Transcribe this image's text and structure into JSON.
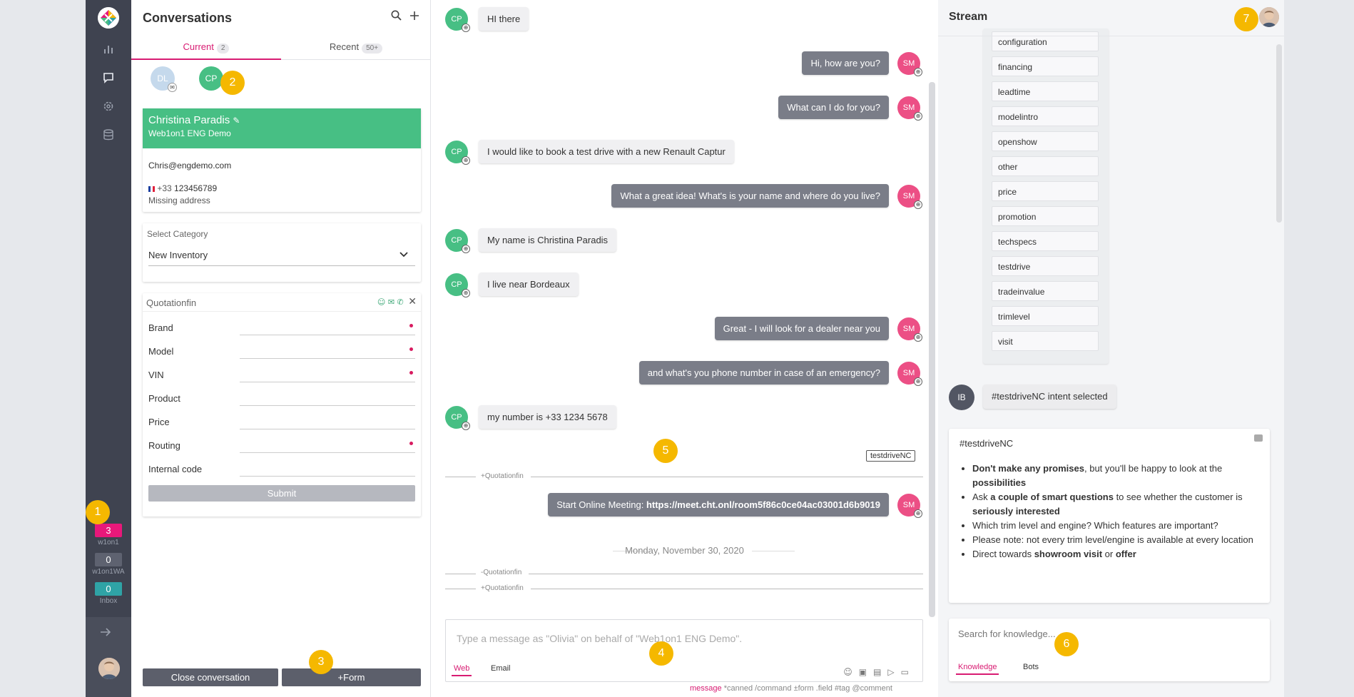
{
  "markers": [
    "1",
    "2",
    "3",
    "4",
    "5",
    "6",
    "7"
  ],
  "rail": {
    "counters": [
      {
        "value": "3",
        "label": "w1on1",
        "color": "#e8187a"
      },
      {
        "value": "0",
        "label": "w1on1WA",
        "color": "#5e6270"
      },
      {
        "value": "0",
        "label": "Inbox",
        "color": "#2fa3a6"
      }
    ],
    "icons": [
      "chart-icon",
      "chat-icon",
      "gear-icon",
      "database-icon",
      "arrow-right-icon"
    ]
  },
  "conversations": {
    "title": "Conversations",
    "tabs": [
      {
        "label": "Current",
        "count": "2"
      },
      {
        "label": "Recent",
        "count": "50+"
      }
    ],
    "avatars": [
      {
        "initials": "DL",
        "color": "#c5d9ec"
      },
      {
        "initials": "CP",
        "color": "#47bf84"
      }
    ],
    "contact": {
      "name": "Christina Paradis",
      "org": "Web1on1 ENG Demo",
      "email": "Chris@engdemo.com",
      "phone_prefix": "+33",
      "phone": "123456789",
      "address": "Missing address"
    },
    "category": {
      "label": "Select Category",
      "value": "New Inventory"
    },
    "form": {
      "title": "Quotationfin",
      "fields": [
        {
          "label": "Brand",
          "required": true
        },
        {
          "label": "Model",
          "required": true
        },
        {
          "label": "VIN",
          "required": true
        },
        {
          "label": "Product",
          "required": false
        },
        {
          "label": "Price",
          "required": false
        },
        {
          "label": "Routing",
          "required": true
        },
        {
          "label": "Internal code",
          "required": false
        }
      ],
      "submit": "Submit"
    },
    "close_button": "Close conversation",
    "form_button": "+Form"
  },
  "chat": {
    "messages": [
      {
        "dir": "in",
        "initials": "CP",
        "text": "HI there"
      },
      {
        "dir": "out",
        "initials": "SM",
        "text": "Hi, how are you?"
      },
      {
        "dir": "out",
        "initials": "SM",
        "text": "What can I do for you?"
      },
      {
        "dir": "in",
        "initials": "CP",
        "text": "I would like to book a test drive with a new Renault Captur"
      },
      {
        "dir": "out",
        "initials": "SM",
        "text": "What a great idea! What's is your name and where do you live?"
      },
      {
        "dir": "in",
        "initials": "CP",
        "text": "My name is Christina Paradis"
      },
      {
        "dir": "in",
        "initials": "CP",
        "text": "I live near Bordeaux"
      },
      {
        "dir": "out",
        "initials": "SM",
        "text": "Great - I will look for a dealer near you"
      },
      {
        "dir": "out",
        "initials": "SM",
        "text": "and what's you phone number in case of an emergency?"
      },
      {
        "dir": "in",
        "initials": "CP",
        "text": "my number is +33 1234 5678"
      }
    ],
    "tag": "testdriveNC",
    "form_events": [
      "+Quotationfin",
      "-Quotationfin",
      "+Quotationfin"
    ],
    "meeting": {
      "prefix": "Start Online Meeting: ",
      "url": "https://meet.cht.onl/room5f86c0ce04ac03001d6b9019",
      "initials": "SM"
    },
    "day": "Monday, November 30, 2020",
    "composer": {
      "placeholder": "Type a message as \"Olivia\"  on behalf of \"Web1on1 ENG Demo\".",
      "tabs": [
        "Web",
        "Email"
      ]
    },
    "hints": [
      "message",
      "*canned",
      "/command",
      "±form",
      ".field",
      "#tag",
      "@comment"
    ]
  },
  "stream": {
    "title": "Stream",
    "intents": [
      "configuration",
      "financing",
      "leadtime",
      "modelintro",
      "openshow",
      "other",
      "price",
      "promotion",
      "techspecs",
      "testdrive",
      "tradeinvalue",
      "trimlevel",
      "visit"
    ],
    "bot": {
      "initials": "IB",
      "message": "#testdriveNC intent selected"
    },
    "knowledge": {
      "title": "#testdriveNC",
      "bullets": [
        [
          {
            "t": "Don't make any promises",
            "b": true
          },
          {
            "t": ", but you'll be happy to look at the ",
            "b": false
          },
          {
            "t": "possibilities",
            "b": true
          }
        ],
        [
          {
            "t": "Ask ",
            "b": false
          },
          {
            "t": "a couple of smart questions",
            "b": true
          },
          {
            "t": " to see whether the customer is ",
            "b": false
          },
          {
            "t": "seriously interested",
            "b": true
          }
        ],
        [
          {
            "t": "Which trim level and engine? Which features are important?",
            "b": false
          }
        ],
        [
          {
            "t": "Please note: not every trim level/engine is available at every location",
            "b": false
          }
        ],
        [
          {
            "t": "Direct towards ",
            "b": false
          },
          {
            "t": "showroom visit",
            "b": true
          },
          {
            "t": " or ",
            "b": false
          },
          {
            "t": "offer",
            "b": true
          }
        ]
      ]
    },
    "search": {
      "placeholder": "Search for knowledge...",
      "tabs": [
        "Knowledge",
        "Bots"
      ]
    }
  },
  "colors": {
    "accent": "#d81b72",
    "customer": "#47bf84",
    "agent": "#ec4f85",
    "marker": "#f5b800"
  }
}
